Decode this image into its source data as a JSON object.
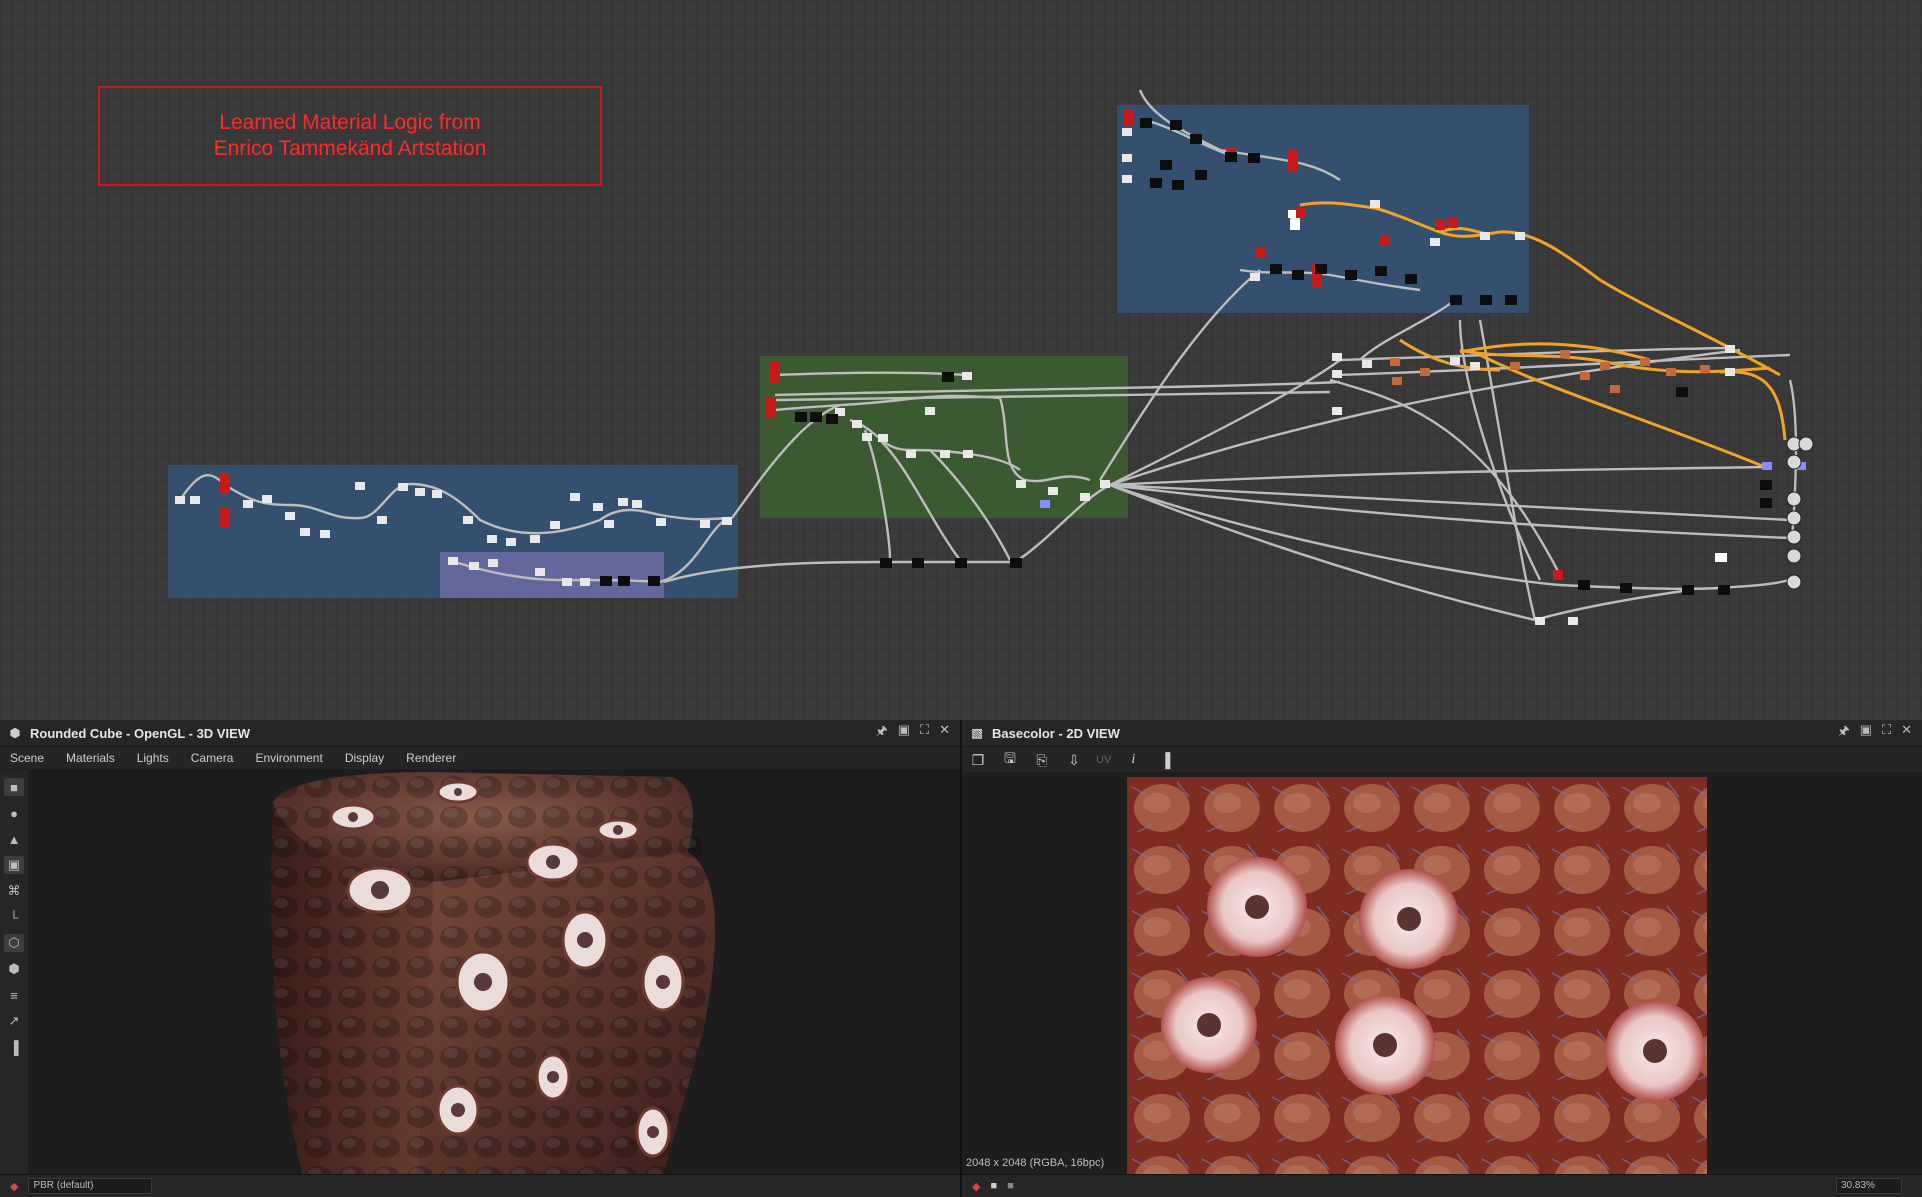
{
  "graph": {
    "comment_line1": "Learned Material Logic from",
    "comment_line2": "Enrico Tammekänd Artstation",
    "frame_colors": {
      "blue": "#34506e",
      "green": "#3b5a31",
      "lavender": "#7676a8"
    },
    "wire_colors": {
      "default": "#bdbdbd",
      "highlight": "#f0a32a"
    }
  },
  "view3d": {
    "icon": "cube-icon",
    "title": "Rounded Cube - OpenGL - 3D VIEW",
    "menu": [
      "Scene",
      "Materials",
      "Lights",
      "Camera",
      "Environment",
      "Display",
      "Renderer"
    ],
    "tools": [
      "camera-icon",
      "light-icon",
      "environment-icon",
      "screenshot-icon",
      "frame-icon",
      "axis-icon",
      "object-icon",
      "wireframe-icon",
      "layers-icon",
      "gizmo-icon",
      "histogram-icon"
    ],
    "status_dropdown": "PBR (default)"
  },
  "view2d": {
    "icon": "image-icon",
    "title": "Basecolor - 2D VIEW",
    "uv_label": "UV",
    "resolution": "2048 x 2048 (RGBA, 16bpc)",
    "zoom": "30.83%"
  },
  "window_controls": [
    "pin-icon",
    "float-icon",
    "maximize-icon",
    "close-icon"
  ]
}
